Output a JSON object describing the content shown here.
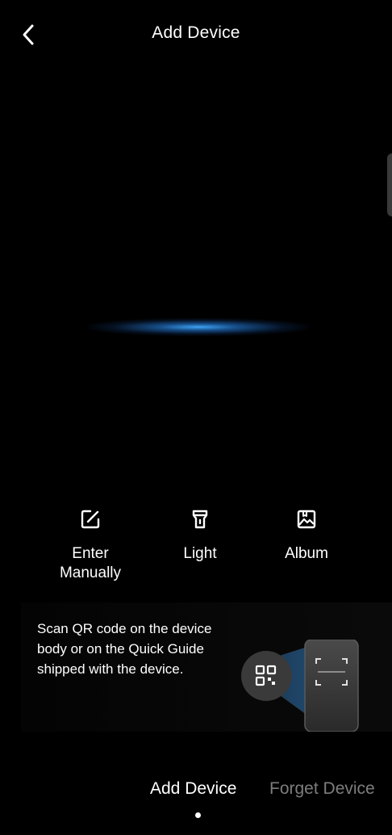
{
  "header": {
    "title": "Add Device",
    "back_icon": "chevron-left-icon"
  },
  "actions": [
    {
      "label": "Enter\nManually",
      "icon": "edit-icon"
    },
    {
      "label": "Light",
      "icon": "flashlight-icon"
    },
    {
      "label": "Album",
      "icon": "album-icon"
    }
  ],
  "hint": {
    "text": "Scan QR code on the device body or on the Quick Guide shipped with the device.",
    "illustration_icon": "qr-code-icon"
  },
  "tabs": {
    "add_device": "Add Device",
    "forget_device": "Forget Device"
  },
  "colors": {
    "background": "#000000",
    "scan_line": "#3fa9ff",
    "inactive_tab": "#7d7d7d"
  }
}
